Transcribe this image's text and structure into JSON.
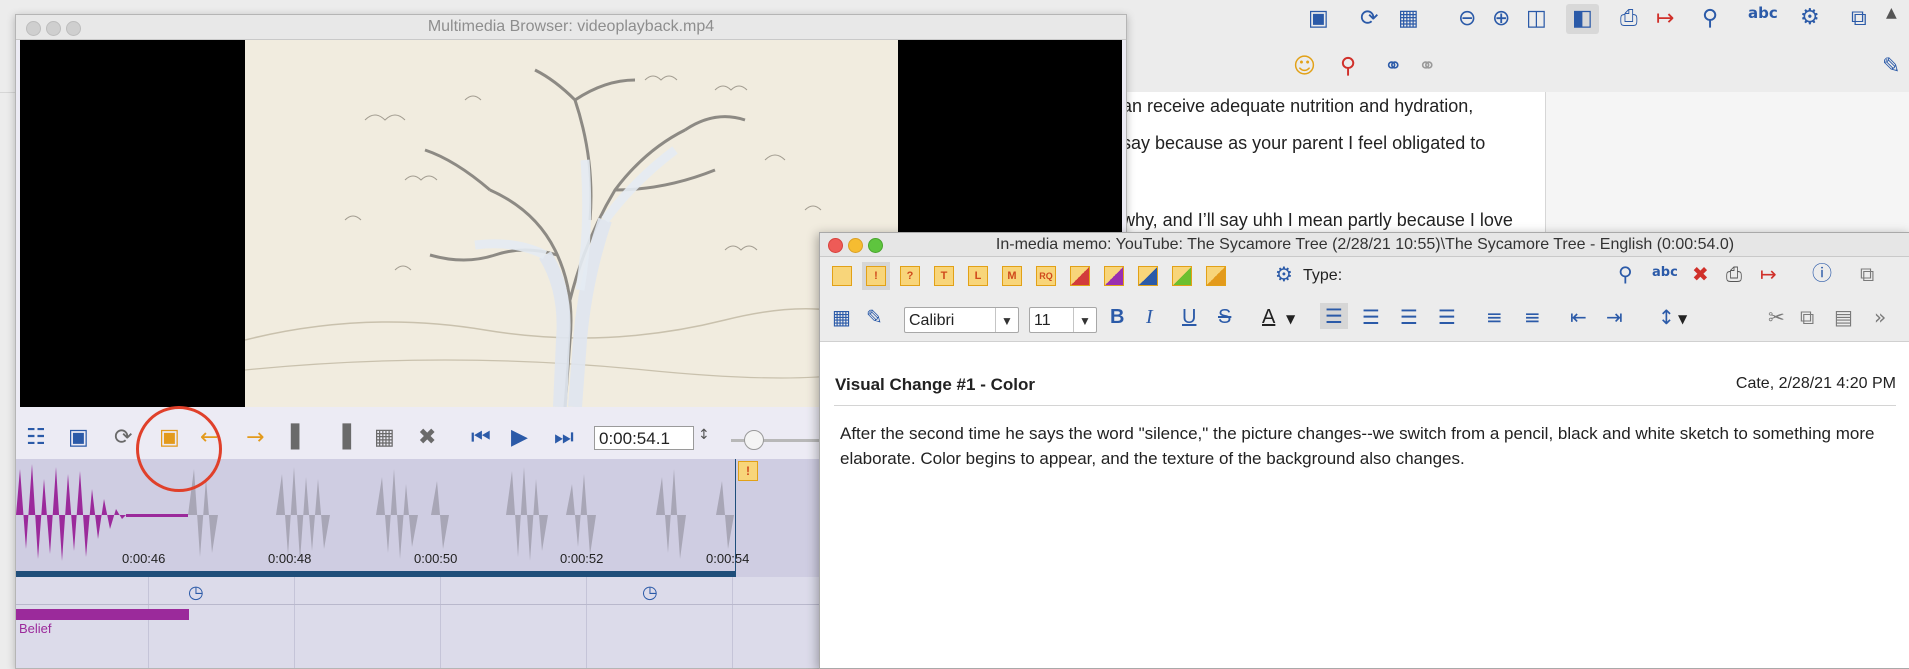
{
  "background_app": {
    "doc_lines": [
      "an receive adequate nutrition and hydration,",
      "say because as your parent I feel obligated to",
      "why, and I’ll say uhh I mean partly because I love"
    ],
    "toolbar_icons": [
      "video-icon",
      "refresh-icon",
      "layout-icon",
      "zoom-out-icon",
      "zoom-in-icon",
      "zoom-percent-icon",
      "panel-icon",
      "print-icon",
      "export-icon",
      "search-icon",
      "spellcheck-icon",
      "gear-icon",
      "window-icon",
      "scroll-up-icon"
    ],
    "highlighter_colors": [
      "#d23b3b",
      "#2b5aa8",
      "#6cbf2f",
      "#e8c31c",
      "#9a2fb0"
    ]
  },
  "multimedia": {
    "title": "Multimedia Browser:  videoplayback.mp4",
    "time_value": "0:00:54.1",
    "ticks": [
      "0:00:46",
      "0:00:48",
      "0:00:50",
      "0:00:52",
      "0:00:54"
    ],
    "track_label": "Belief",
    "colors": {
      "waveform_played": "#9b2a9b",
      "waveform": "#a8a6b6",
      "track": "#9b2a9b",
      "highlight_circle": "#e0402a"
    }
  },
  "memo": {
    "title": "In-media memo: YouTube: The Sycamore Tree (2/28/21 10:55)\\The Sycamore Tree - English (0:00:54.0)",
    "type_label": "Type:",
    "memo_type_glyphs": [
      "",
      "!",
      "?",
      "T",
      "L",
      "M",
      "RQ"
    ],
    "font_name": "Calibri",
    "font_size": "11",
    "heading": "Visual Change #1 - Color",
    "author_date": "Cate, 2/28/21 4:20 PM",
    "body": "After the second time he says the word \"silence,\" the picture changes--we switch from a pencil, black and white sketch to something more elaborate. Color begins to appear, and the texture of the background also changes."
  }
}
